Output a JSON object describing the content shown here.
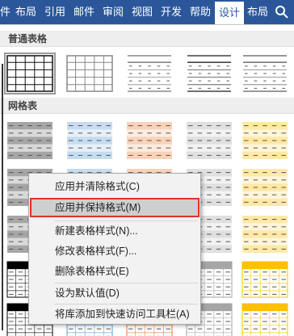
{
  "ribbon": {
    "tabs": [
      {
        "label": "件"
      },
      {
        "label": "布局"
      },
      {
        "label": "引用"
      },
      {
        "label": "邮件"
      },
      {
        "label": "审阅"
      },
      {
        "label": "视图"
      },
      {
        "label": "开发"
      },
      {
        "label": "帮助"
      },
      {
        "label": "设计"
      },
      {
        "label": "布局"
      }
    ],
    "active_tab": "设计",
    "accent": "#2b579a",
    "search_icon": "search-icon"
  },
  "gallery": {
    "plain_tables_title": "普通表格",
    "grid_tables_title": "网格表",
    "style_colors": [
      "#000000",
      "#5b9bd5",
      "#ed7d31",
      "#a5a5a5",
      "#ffc000"
    ]
  },
  "context_menu": {
    "items": [
      {
        "label": "应用并清除格式(C)"
      },
      {
        "label": "应用并保持格式(M)"
      },
      {
        "label": "新建表格样式(N)..."
      },
      {
        "label": "修改表格样式(F)..."
      },
      {
        "label": "删除表格样式(E)"
      },
      {
        "label": "设为默认值(D)"
      },
      {
        "label": "将库添加到快速访问工具栏(A)"
      }
    ],
    "highlight_color": "#cfcfcf",
    "callout_color": "#e0312a"
  }
}
